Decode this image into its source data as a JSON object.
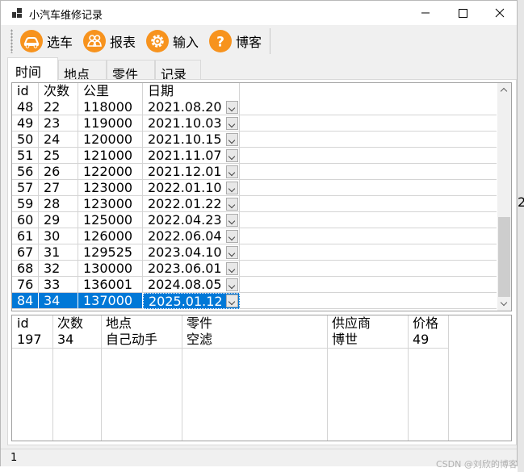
{
  "window": {
    "title": "小汽车维修记录",
    "right_fragment": "2"
  },
  "toolbar": {
    "buttons": [
      {
        "label": "选车",
        "icon": "car-icon"
      },
      {
        "label": "报表",
        "icon": "people-icon"
      },
      {
        "label": "输入",
        "icon": "gear-icon"
      },
      {
        "label": "博客",
        "icon": "question-icon"
      }
    ]
  },
  "tabs": [
    "时间",
    "地点",
    "零件",
    "记录"
  ],
  "upper_grid": {
    "columns": [
      "id",
      "次数",
      "公里",
      "日期"
    ],
    "rows": [
      [
        "48",
        "22",
        "118000",
        "2021.08.20"
      ],
      [
        "49",
        "23",
        "119000",
        "2021.10.03"
      ],
      [
        "50",
        "24",
        "120000",
        "2021.10.15"
      ],
      [
        "51",
        "25",
        "121000",
        "2021.11.07"
      ],
      [
        "56",
        "26",
        "122000",
        "2021.12.01"
      ],
      [
        "57",
        "27",
        "123000",
        "2022.01.10"
      ],
      [
        "59",
        "28",
        "123000",
        "2022.01.22"
      ],
      [
        "60",
        "29",
        "125000",
        "2022.04.23"
      ],
      [
        "61",
        "30",
        "126000",
        "2022.06.04"
      ],
      [
        "67",
        "31",
        "129525",
        "2023.04.10"
      ],
      [
        "68",
        "32",
        "130000",
        "2023.06.01"
      ],
      [
        "76",
        "33",
        "136001",
        "2024.08.05"
      ],
      [
        "84",
        "34",
        "137000",
        "2025.01.12"
      ]
    ],
    "selected_row": 12
  },
  "lower_grid": {
    "columns": [
      "id",
      "次数",
      "地点",
      "零件",
      "供应商",
      "价格"
    ],
    "rows": [
      [
        "197",
        "34",
        "自己动手",
        "空滤",
        "博世",
        "49"
      ]
    ]
  },
  "status": {
    "text": "1"
  },
  "watermark": "CSDN @刘欣的博客"
}
